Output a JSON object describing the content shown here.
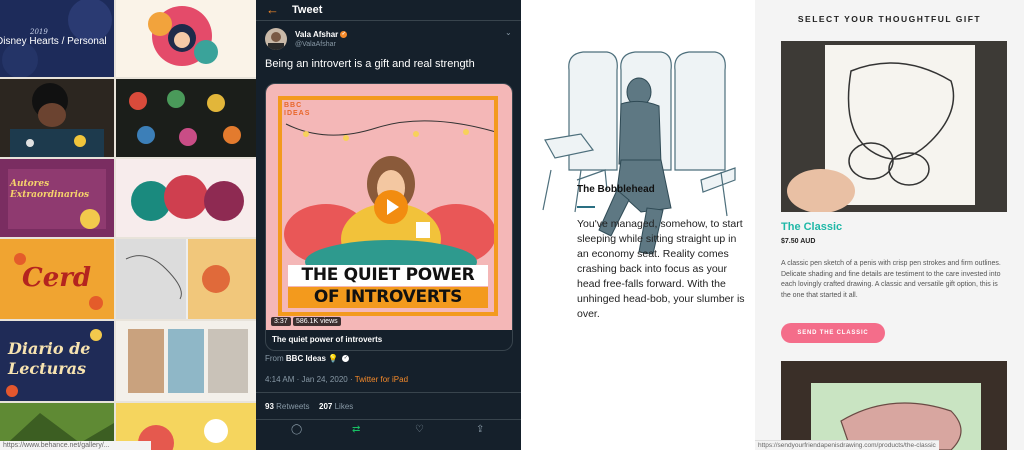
{
  "gallery": {
    "year": "2019",
    "caption": "Disney Hearts / Personal",
    "tile_titles": [
      "Autores Extraordinarios",
      "Diario de Lecturas",
      "Cerd"
    ],
    "status_url": "https://www.behance.net/gallery/..."
  },
  "tweet": {
    "header_title": "Tweet",
    "author_name": "Vala Afshar",
    "author_handle": "@ValaAfshar",
    "text": "Being an introvert is a gift and real strength",
    "media_brand": "BBC IDEAS",
    "headline_line1": "THE QUIET POWER",
    "headline_line2": "OF INTROVERTS",
    "duration": "3:37",
    "views": "586.1K views",
    "card_title": "The quiet power of introverts",
    "from_label": "From",
    "from_name": "BBC Ideas",
    "timestamp": "4:14 AM · Jan 24, 2020 · ",
    "source": "Twitter for iPad",
    "retweets_count": "93",
    "retweets_label": "Retweets",
    "likes_count": "207",
    "likes_label": "Likes"
  },
  "article": {
    "title": "The Bobblehead",
    "body": "You've managed, somehow, to start sleeping while sitting straight up in an economy seat. Reality comes crashing back into focus as your head free-falls forward. With the unhinged head-bob, your slumber is over."
  },
  "shop": {
    "heading": "SELECT YOUR THOUGHTFUL GIFT",
    "product_name": "The Classic",
    "price": "$7.50 AUD",
    "description": "A classic pen sketch of a penis with crisp pen strokes and firm outlines. Delicate shading and fine details are testiment to the care invested into each lovingly crafted drawing. A classic and versatile gift option, this is the one that started it all.",
    "button": "SEND THE CLASSIC",
    "status_url": "https://sendyourfriendapenisdrawing.com/products/the-classic"
  },
  "colors": {
    "twitter_bg": "#15202b",
    "accent_orange": "#f58a2a",
    "shop_teal": "#1fb8a7",
    "shop_pink": "#f46d8a"
  }
}
